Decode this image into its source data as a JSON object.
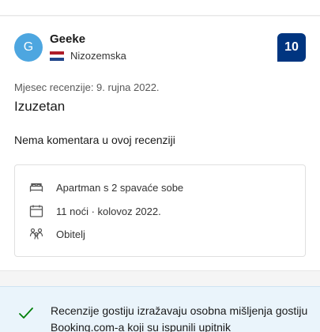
{
  "reviewer": {
    "initial": "G",
    "name": "Geeke",
    "country": "Nizozemska"
  },
  "score": "10",
  "review": {
    "date": "Mjesec recenzije: 9. rujna 2022.",
    "title": "Izuzetan",
    "comment": "Nema komentara u ovoj recenziji"
  },
  "stay": {
    "room": "Apartman s 2 spavaće sobe",
    "nights": "11 noći · kolovoz 2022.",
    "traveler_type": "Obitelj"
  },
  "notice": {
    "text": "Recenzije gostiju izražavaju osobna mišljenja gostiju Booking.com-a koji su ispunili upitnik"
  },
  "colors": {
    "score_bg": "#003580",
    "avatar_bg": "#4da6e0",
    "notice_bg": "#eaf4fb",
    "check": "#008009"
  }
}
